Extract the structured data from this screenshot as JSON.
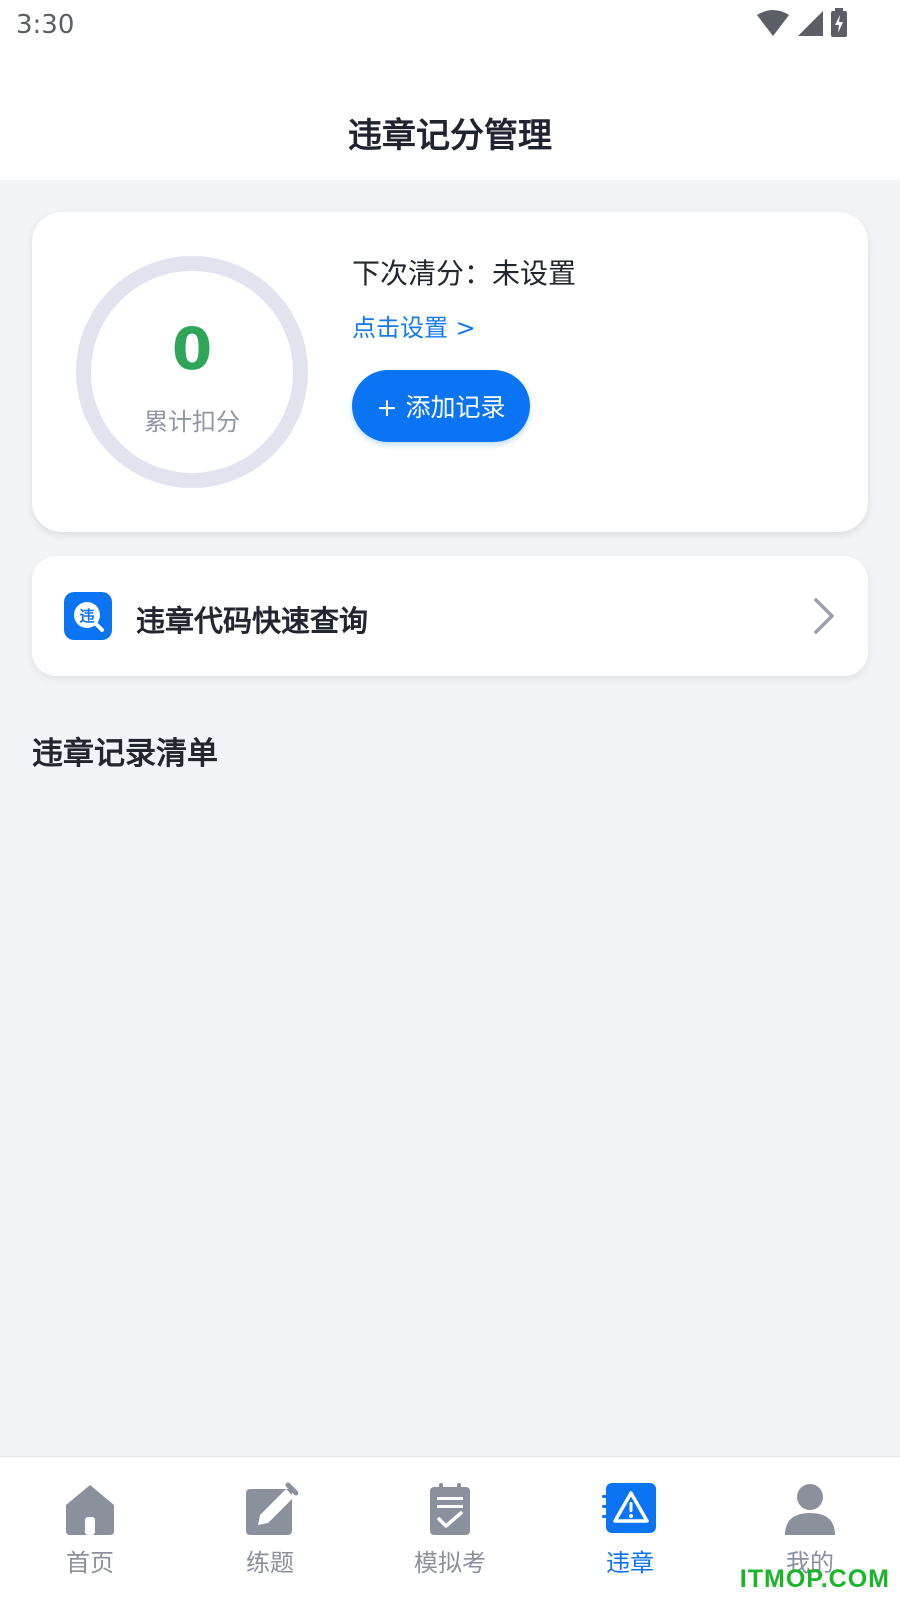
{
  "status_bar": {
    "time": "3:30",
    "icons": [
      "wifi-icon",
      "signal-icon",
      "battery-icon"
    ]
  },
  "header": {
    "title": "违章记分管理"
  },
  "score_card": {
    "score": "0",
    "score_label": "累计扣分",
    "next_clear_text": "下次清分：未设置",
    "set_link": "点击设置 >",
    "add_button": "+ 添加记录"
  },
  "quick_query": {
    "icon_char": "违",
    "label": "违章代码快速查询"
  },
  "records": {
    "title": "违章记录清单",
    "items": []
  },
  "tabbar": {
    "tabs": [
      {
        "label": "首页",
        "icon": "home-icon",
        "active": false
      },
      {
        "label": "练题",
        "icon": "edit-icon",
        "active": false
      },
      {
        "label": "模拟考",
        "icon": "exam-icon",
        "active": false
      },
      {
        "label": "违章",
        "icon": "warning-icon",
        "active": true
      },
      {
        "label": "我的",
        "icon": "user-icon",
        "active": false
      }
    ]
  },
  "watermark": "ITMOP.COM",
  "colors": {
    "accent": "#0a74f4",
    "score_green": "#2ea65a",
    "background": "#f2f4f8",
    "tab_inactive": "#8a909c"
  }
}
